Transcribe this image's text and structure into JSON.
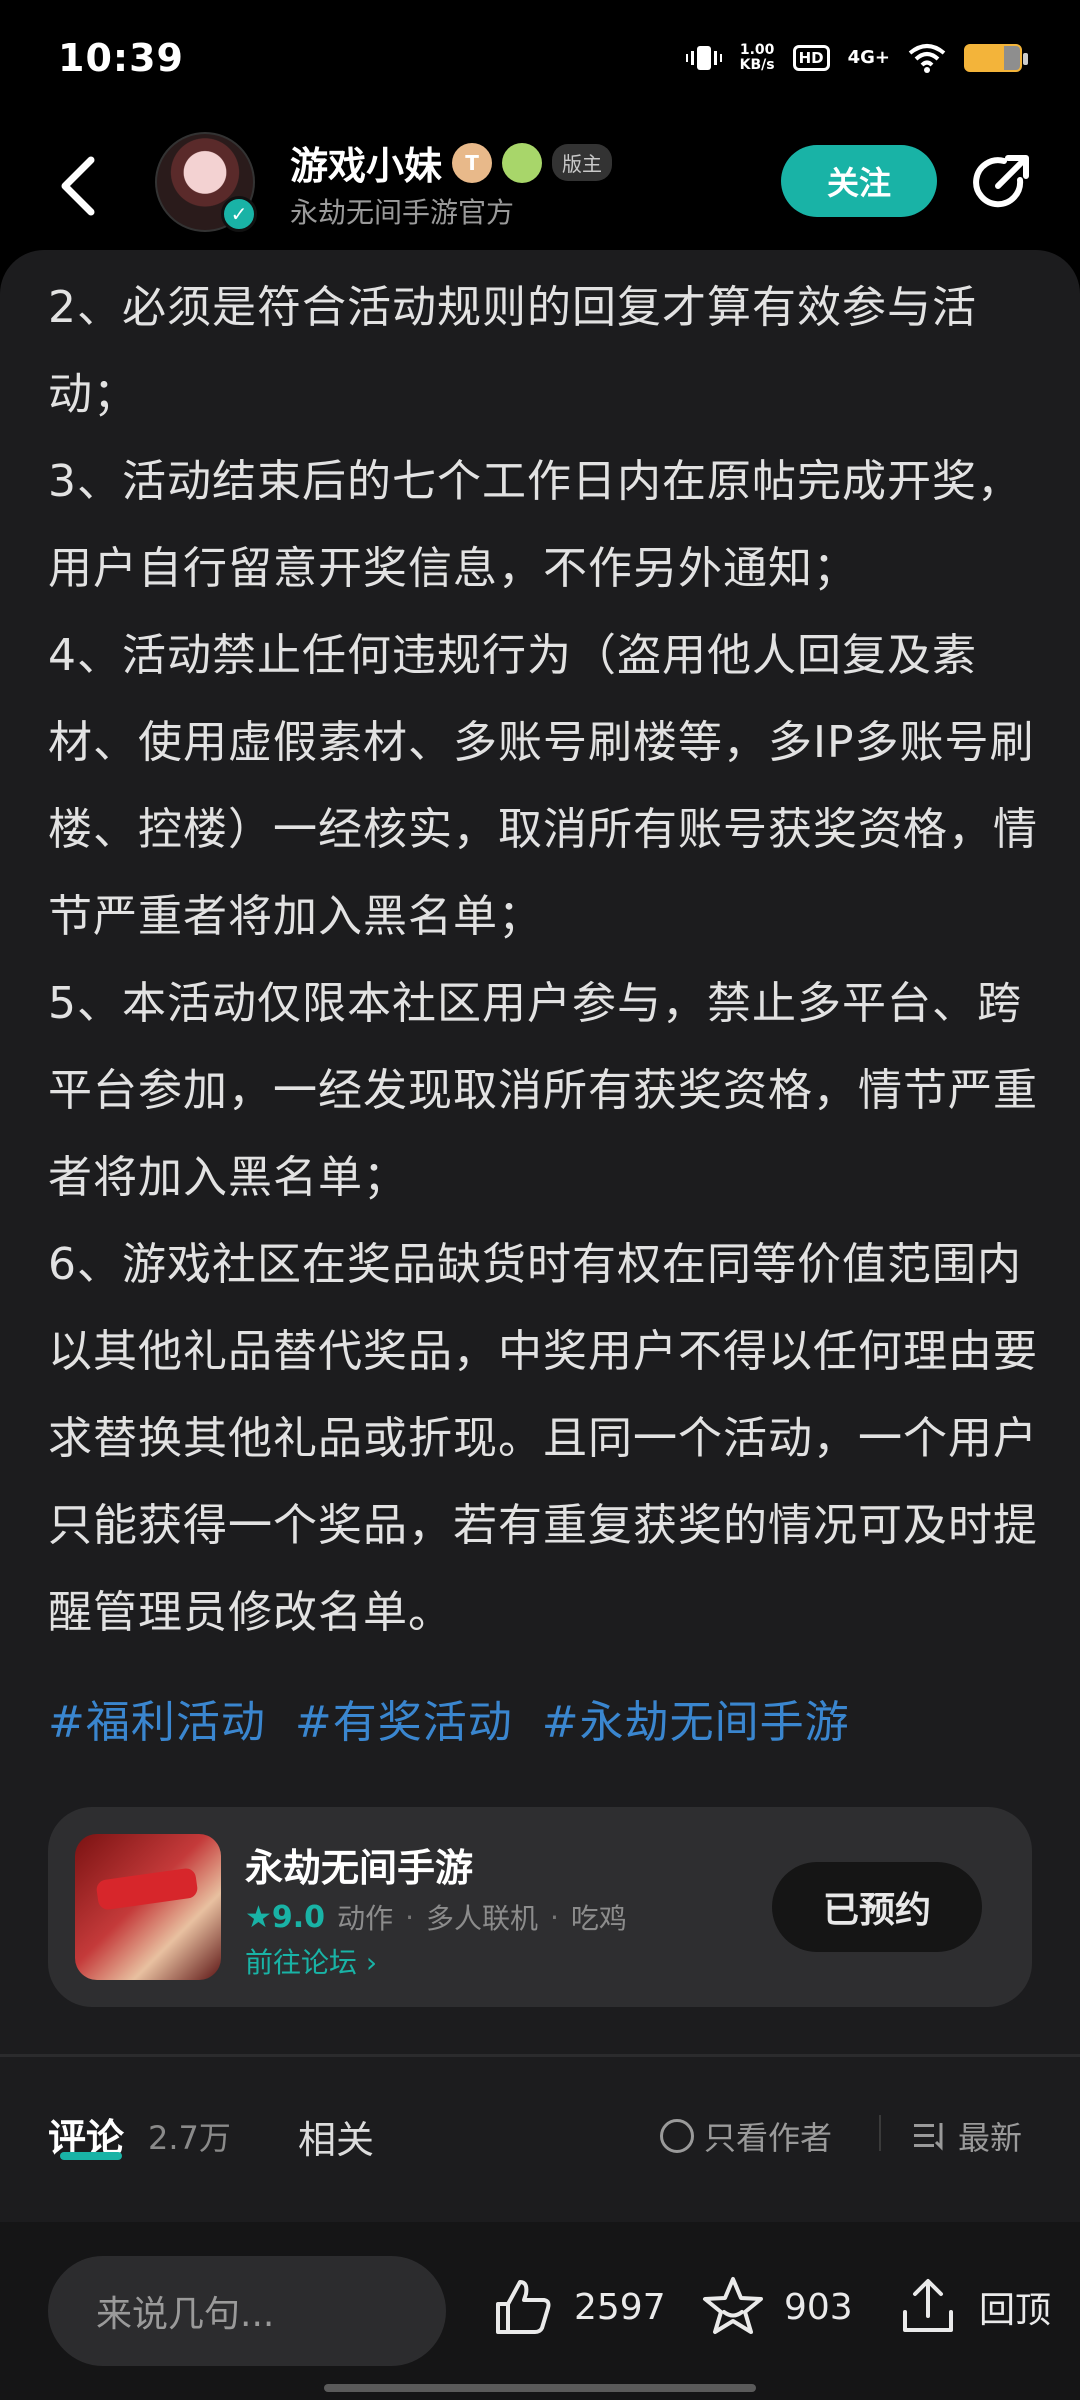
{
  "status_bar": {
    "time": "10:39",
    "net_speed_value": "1.00",
    "net_speed_unit": "KB/s",
    "hd": "HD",
    "network": "4G+"
  },
  "header": {
    "user_name": "游戏小妹",
    "badge_letter": "T",
    "role_badge": "版主",
    "subtitle": "永劫无间手游官方",
    "follow_label": "关注"
  },
  "post": {
    "paragraphs": [
      "2、必须是符合活动规则的回复才算有效参与活动；",
      "3、活动结束后的七个工作日内在原帖完成开奖，用户自行留意开奖信息，不作另外通知；",
      "4、活动禁止任何违规行为（盗用他人回复及素材、使用虚假素材、多账号刷楼等，多IP多账号刷楼、控楼）一经核实，取消所有账号获奖资格，情节严重者将加入黑名单；",
      "5、本活动仅限本社区用户参与，禁止多平台、跨平台参加，一经发现取消所有获奖资格，情节严重者将加入黑名单；",
      "6、游戏社区在奖品缺货时有权在同等价值范围内以其他礼品替代奖品，中奖用户不得以任何理由要求替换其他礼品或折现。且同一个活动，一个用户只能获得一个奖品，若有重复获奖的情况可及时提醒管理员修改名单。"
    ],
    "tags": [
      "#福利活动",
      "#有奖活动",
      "#永劫无间手游"
    ]
  },
  "game_card": {
    "title": "永劫无间手游",
    "rating": "9.0",
    "genres": [
      "动作",
      "多人联机",
      "吃鸡"
    ],
    "forum_link": "前往论坛",
    "reserve_label": "已预约"
  },
  "comments_bar": {
    "tab_comment": "评论",
    "comment_count": "2.7万",
    "tab_related": "相关",
    "only_author": "只看作者",
    "sort_latest": "最新"
  },
  "bottom_bar": {
    "input_placeholder": "来说几句...",
    "like_count": "2597",
    "fav_count": "903",
    "back_top": "回顶"
  },
  "colors": {
    "accent": "#19b3a6",
    "tag": "#3a86cf",
    "background": "#1c1c1e"
  }
}
